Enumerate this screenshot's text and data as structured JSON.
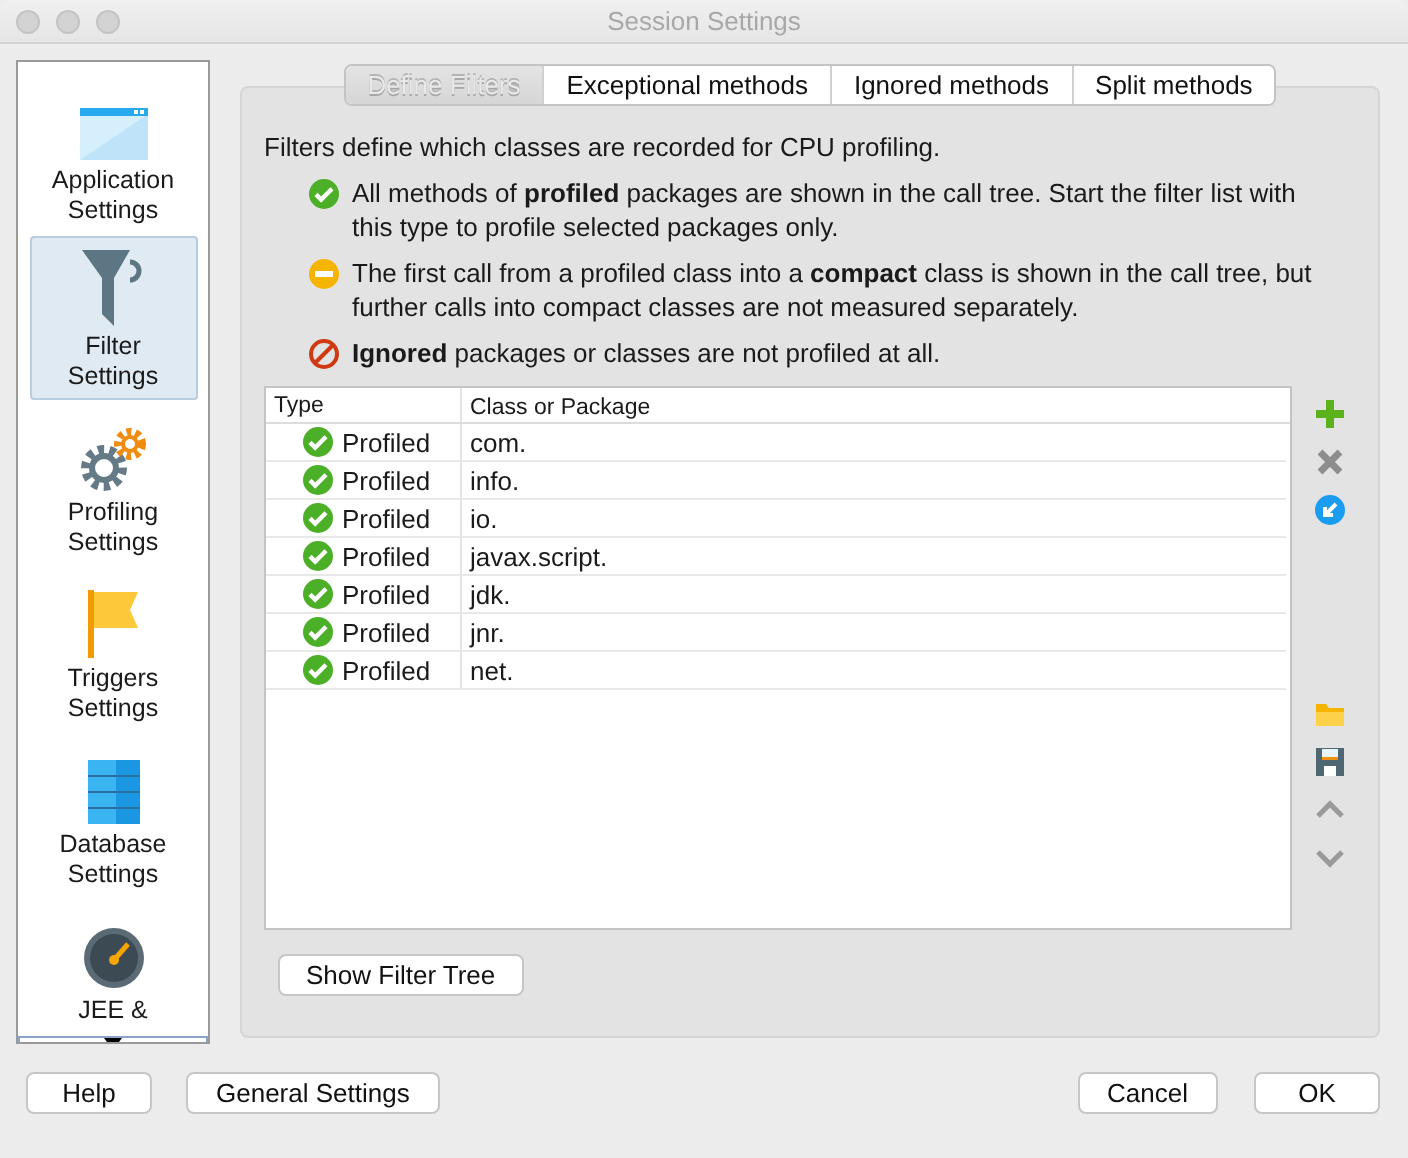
{
  "window": {
    "title": "Session Settings"
  },
  "sidebar": {
    "items": [
      {
        "kind": "application",
        "label": "Application Settings",
        "selected": false
      },
      {
        "kind": "filter",
        "label": "Filter Settings",
        "selected": true
      },
      {
        "kind": "profiling",
        "label": "Profiling Settings",
        "selected": false
      },
      {
        "kind": "triggers",
        "label": "Triggers Settings",
        "selected": false
      },
      {
        "kind": "database",
        "label": "Database Settings",
        "selected": false
      },
      {
        "kind": "jee",
        "label": "JEE &",
        "selected": false
      }
    ]
  },
  "tabs": [
    {
      "label": "Define Filters",
      "selected": true
    },
    {
      "label": "Exceptional methods",
      "selected": false
    },
    {
      "label": "Ignored methods",
      "selected": false
    },
    {
      "label": "Split methods",
      "selected": false
    }
  ],
  "intro": "Filters define which classes are recorded for CPU profiling.",
  "legend": [
    {
      "kind": "profiled",
      "text": "All methods of **profiled** packages are shown in the call tree. Start the filter list with this type to profile selected packages only."
    },
    {
      "kind": "compact",
      "text": "The first call from a profiled class into a **compact** class is shown in the call tree, but further calls into compact classes are not measured separately."
    },
    {
      "kind": "ignored",
      "text": "**Ignored** packages or classes are not profiled at all."
    }
  ],
  "table": {
    "columns": [
      "Type",
      "Class or Package"
    ],
    "rows": [
      {
        "kind": "profiled",
        "type": "Profiled",
        "class": "com."
      },
      {
        "kind": "profiled",
        "type": "Profiled",
        "class": "info."
      },
      {
        "kind": "profiled",
        "type": "Profiled",
        "class": "io."
      },
      {
        "kind": "profiled",
        "type": "Profiled",
        "class": "javax.script."
      },
      {
        "kind": "profiled",
        "type": "Profiled",
        "class": "jdk."
      },
      {
        "kind": "profiled",
        "type": "Profiled",
        "class": "jnr."
      },
      {
        "kind": "profiled",
        "type": "Profiled",
        "class": "net."
      }
    ]
  },
  "show_tree_button": "Show Filter Tree",
  "footer": {
    "left": [
      "Help",
      "General Settings"
    ],
    "right": [
      "Cancel",
      "OK"
    ]
  }
}
